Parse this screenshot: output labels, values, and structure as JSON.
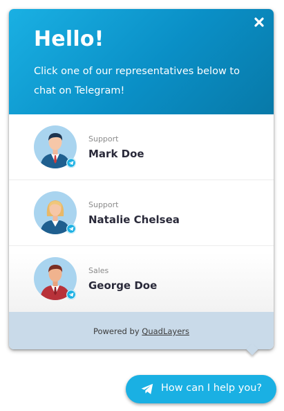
{
  "colors": {
    "accent": "#1ab0e3",
    "header_dark": "#0879a8",
    "footer_bg": "#c9dae9",
    "name_text": "#2a2a3a",
    "role_text": "#8a8a8a"
  },
  "popup": {
    "close_icon": "close-icon",
    "title": "Hello!",
    "intro": "Click one of our representatives below to chat on Telegram!",
    "agents": [
      {
        "role": "Support",
        "name": "Mark Doe",
        "avatar": "male-agent-avatar",
        "badge_icon": "telegram-icon"
      },
      {
        "role": "Support",
        "name": "Natalie Chelsea",
        "avatar": "female-agent-avatar",
        "badge_icon": "telegram-icon"
      },
      {
        "role": "Sales",
        "name": "George Doe",
        "avatar": "male-agent-avatar",
        "badge_icon": "telegram-icon"
      }
    ],
    "footer": {
      "prefix": "Powered by",
      "link": "QuadLayers"
    }
  },
  "launcher": {
    "icon": "telegram-plane-icon",
    "label": "How can I help you?"
  }
}
